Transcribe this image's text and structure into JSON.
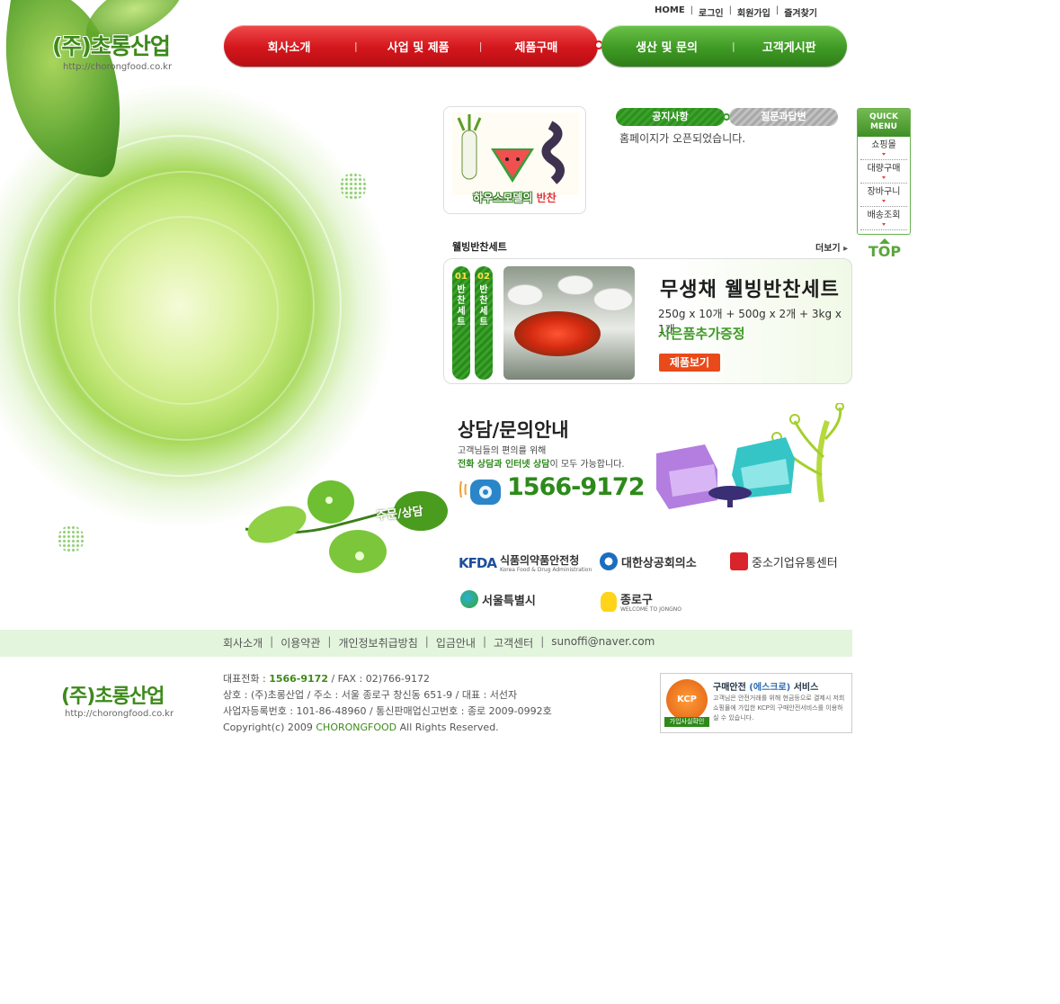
{
  "site": {
    "logo_name": "(주)초롱산업",
    "logo_url": "http://chorongfood.co.kr",
    "order_label": "주문/상담"
  },
  "top_links": [
    "HOME",
    "로그인",
    "회원가입",
    "즐겨찾기"
  ],
  "nav": {
    "red": [
      "회사소개",
      "사업 및 제품",
      "제품구매"
    ],
    "green": [
      "생산 및 문의",
      "고객게시판"
    ]
  },
  "house_model": {
    "caption_a": "하우스모델의",
    "caption_b": "반찬"
  },
  "notice": {
    "tabs": [
      "공지사항",
      "질문과답변"
    ],
    "items": [
      "홈페이지가 오픈되었습니다."
    ]
  },
  "quick_menu": {
    "head": [
      "QUICK",
      "MENU"
    ],
    "items": [
      "쇼핑몰",
      "대량구매",
      "장바구니",
      "배송조회"
    ],
    "top": "TOP"
  },
  "wellbeing": {
    "section_title": "웰빙반찬세트",
    "more": "더보기",
    "tabs": [
      {
        "num": "01",
        "label": "반찬세트"
      },
      {
        "num": "02",
        "label": "반찬세트"
      }
    ],
    "title": "무생채 웰빙반찬세트",
    "spec": "250g x 10개 + 500g x 2개 + 3kg x 1개",
    "gift": "사은품추가증정",
    "button": "제품보기"
  },
  "consult": {
    "title": "상담/문의안내",
    "sub1": "고객님들의 편의를 위해",
    "sub2_highlight": "전화 상담과 인터넷 상담",
    "sub2_rest": "이 모두 가능합니다.",
    "phone": "1566-9172"
  },
  "partners": [
    {
      "name": "식품의약품안전청",
      "sub": "Korea Food & Drug Administration",
      "mark": "KFDA"
    },
    {
      "name": "대한상공회의소",
      "sub": "",
      "mark": ""
    },
    {
      "name": "중소기업유통센터",
      "sub": "",
      "mark": ""
    },
    {
      "name": "서울특별시",
      "sub": "",
      "mark": ""
    },
    {
      "name": "종로구",
      "sub": "WELCOME TO JONGNO",
      "mark": ""
    }
  ],
  "footer": {
    "links": [
      "회사소개",
      "이용약관",
      "개인정보취급방침",
      "입금안내",
      "고객센터",
      "sunoffi@naver.com"
    ],
    "line1_a": "대표전화 : ",
    "line1_tel": "1566-9172",
    "line1_b": " / FAX : 02)766-9172",
    "line2": "상호 : (주)초롱산업 / 주소 : 서울 종로구 창신동 651-9 / 대표 : 서선자",
    "line3": "사업자등록번호 : 101-86-48960 / 통신판매업신고번호 : 종로 2009-0992호",
    "line4_a": "Copyright(c) 2009 ",
    "line4_brand": "CHORONGFOOD",
    "line4_b": " All Rights Reserved."
  },
  "kcp": {
    "badge": "KCP",
    "ribbon": "가입사실확인",
    "title_a": "구매안전 ",
    "title_b": "(에스크로)",
    "title_c": " 서비스",
    "desc": "고객님은 안전거래를 위해 현금등으로 결제시 저희 쇼핑몰에 가입한 KCP의 구매안전서비스를 이용하실 수 있습니다."
  }
}
